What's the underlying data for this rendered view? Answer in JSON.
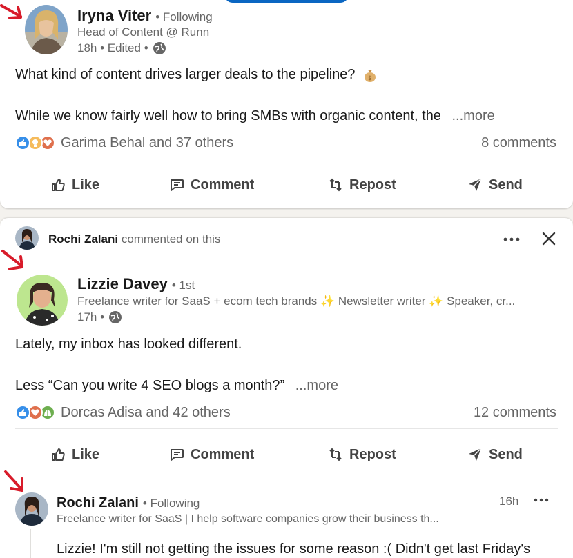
{
  "post1": {
    "author": "Iryna Viter",
    "degree": "• Following",
    "headline": "Head of Content @ Runn",
    "meta": "18h • Edited •",
    "text_line1": "What kind of content drives larger deals to the pipeline?",
    "text_line2": "While we know fairly well how to bring SMBs with organic content, the",
    "more": "...more",
    "reactions_text": "Garima Behal and 37 others",
    "comments": "8 comments",
    "reaction_icons": [
      "like-icon",
      "insightful-icon",
      "love-icon"
    ],
    "emoji": "money-bag-icon"
  },
  "actions": {
    "like": "Like",
    "comment": "Comment",
    "repost": "Repost",
    "send": "Send"
  },
  "post2": {
    "context_name": "Rochi Zalani",
    "context_text": "commented on this",
    "author": "Lizzie Davey",
    "degree": "• 1st",
    "headline": "Freelance writer for SaaS + ecom tech brands ✨ Newsletter writer ✨ Speaker, cr...",
    "meta": "17h •",
    "text_line1": "Lately, my inbox has looked different.",
    "text_line2": "Less “Can you write 4 SEO blogs a month?”",
    "more": "...more",
    "reactions_text": "Dorcas Adisa and 42 others",
    "comments": "12 comments",
    "reaction_icons": [
      "like-icon",
      "love-icon",
      "support-icon"
    ]
  },
  "comment": {
    "author": "Rochi Zalani",
    "degree": "• Following",
    "headline": "Freelance writer for SaaS | I help software companies grow their business th...",
    "time": "16h",
    "text": "Lizzie! I'm still not getting the issues for some reason :( Didn't get last Friday's"
  },
  "colors": {
    "brand_blue": "#0a66c2",
    "arrow_red": "#d81b2a",
    "muted": "#666666"
  }
}
